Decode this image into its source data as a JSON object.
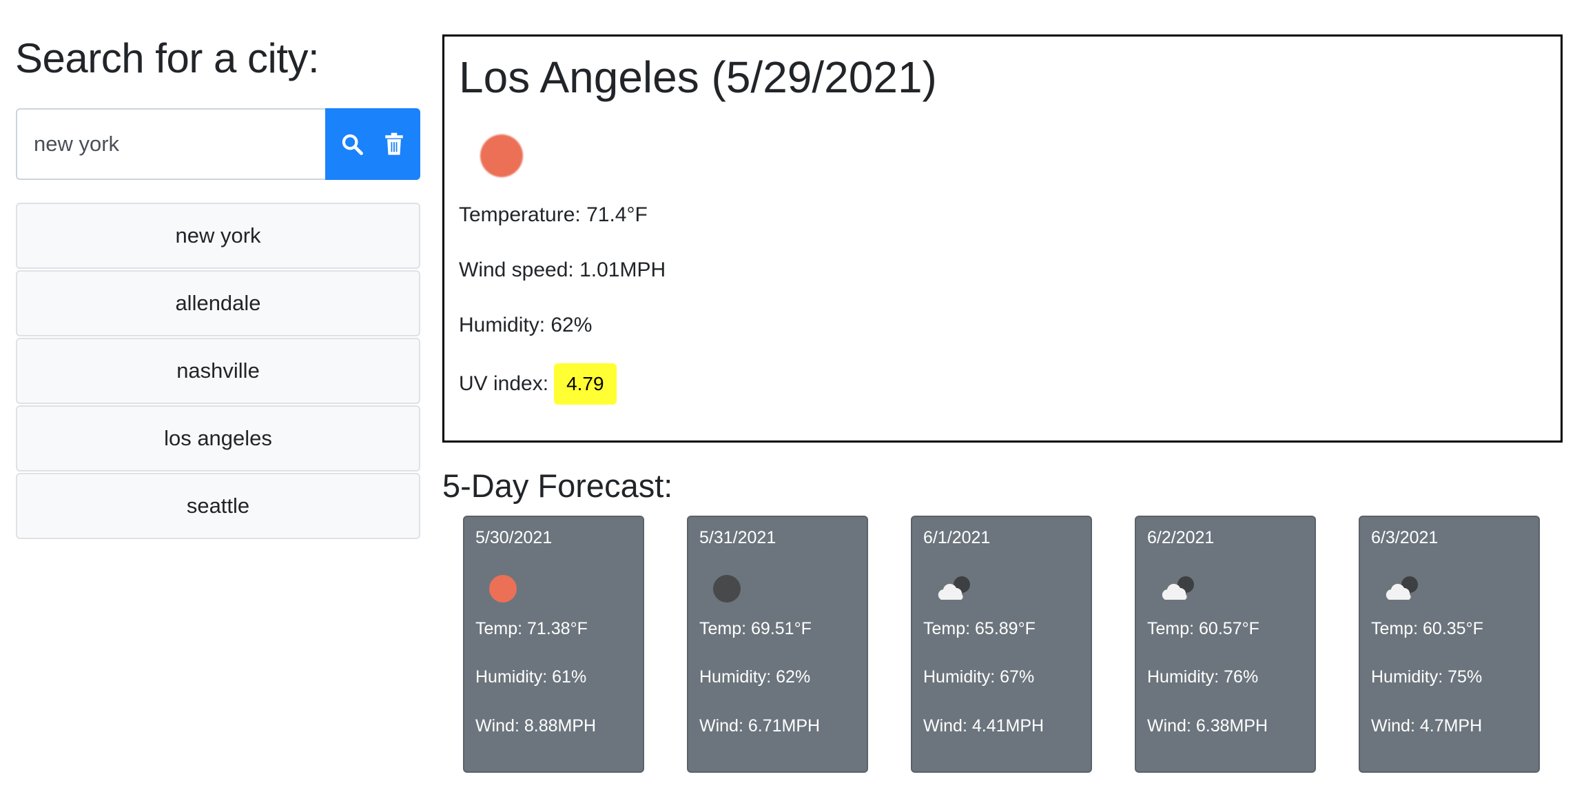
{
  "search": {
    "heading": "Search for a city:",
    "input_value": "new york",
    "search_icon": "search-icon",
    "clear_icon": "trash-icon",
    "history": [
      "new york",
      "allendale",
      "nashville",
      "los angeles",
      "seattle"
    ]
  },
  "current": {
    "title": "Los Angeles (5/29/2021)",
    "icon": "clear-sky-day-icon",
    "temperature": "Temperature: 71.4°F",
    "wind": "Wind speed: 1.01MPH",
    "humidity": "Humidity: 62%",
    "uv_label": "UV index:",
    "uv_value": "4.79",
    "uv_color": "#ffff33"
  },
  "forecast": {
    "heading": "5-Day Forecast:",
    "card_color": "#6c757d",
    "days": [
      {
        "date": "5/30/2021",
        "icon": "sun-icon",
        "temp": "Temp: 71.38°F",
        "humidity": "Humidity: 61%",
        "wind": "Wind: 8.88MPH"
      },
      {
        "date": "5/31/2021",
        "icon": "moon-icon",
        "temp": "Temp: 69.51°F",
        "humidity": "Humidity: 62%",
        "wind": "Wind: 6.71MPH"
      },
      {
        "date": "6/1/2021",
        "icon": "cloud-night-icon",
        "temp": "Temp: 65.89°F",
        "humidity": "Humidity: 67%",
        "wind": "Wind: 4.41MPH"
      },
      {
        "date": "6/2/2021",
        "icon": "cloud-night-icon",
        "temp": "Temp: 60.57°F",
        "humidity": "Humidity: 76%",
        "wind": "Wind: 6.38MPH"
      },
      {
        "date": "6/3/2021",
        "icon": "cloud-night-icon",
        "temp": "Temp: 60.35°F",
        "humidity": "Humidity: 75%",
        "wind": "Wind: 4.7MPH"
      }
    ]
  }
}
